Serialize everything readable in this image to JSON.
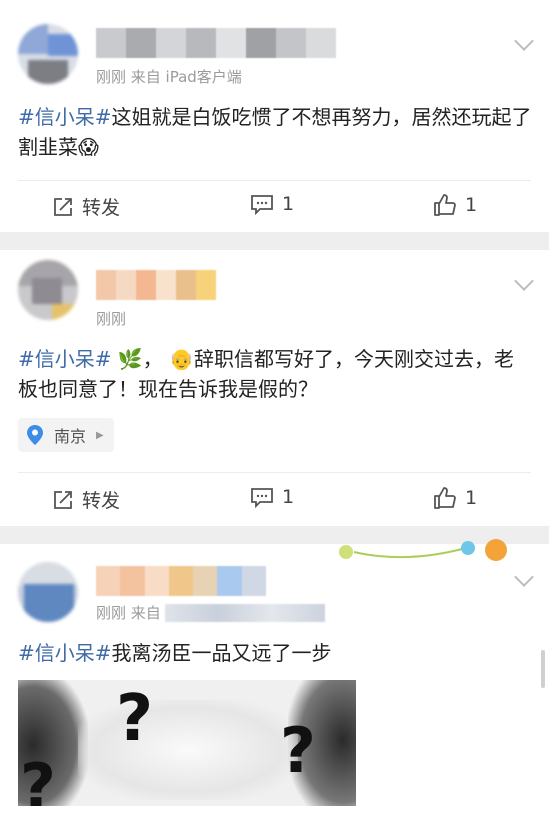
{
  "posts": [
    {
      "meta": "刚刚  来自 iPad客户端",
      "hashtag": "#信小呆#",
      "text": "这姐就是白饭吃惯了不想再努力，居然还玩起了割韭菜",
      "emoji": "😱",
      "repost_label": "转发",
      "comment_count": "1",
      "like_count": "1"
    },
    {
      "meta": "刚刚",
      "hashtag": "#信小呆#",
      "text_emoji_a": "🌿",
      "text_sep": "，",
      "text_emoji_b": "👴",
      "text": "辞职信都写好了，今天刚交过去，老板也同意了！现在告诉我是假的？",
      "location": "南京",
      "repost_label": "转发",
      "comment_count": "1",
      "like_count": "1"
    },
    {
      "meta_prefix": "刚刚  来自",
      "hashtag": "#信小呆#",
      "text": "我离汤臣一品又远了一步",
      "image_glyph": "?"
    }
  ]
}
